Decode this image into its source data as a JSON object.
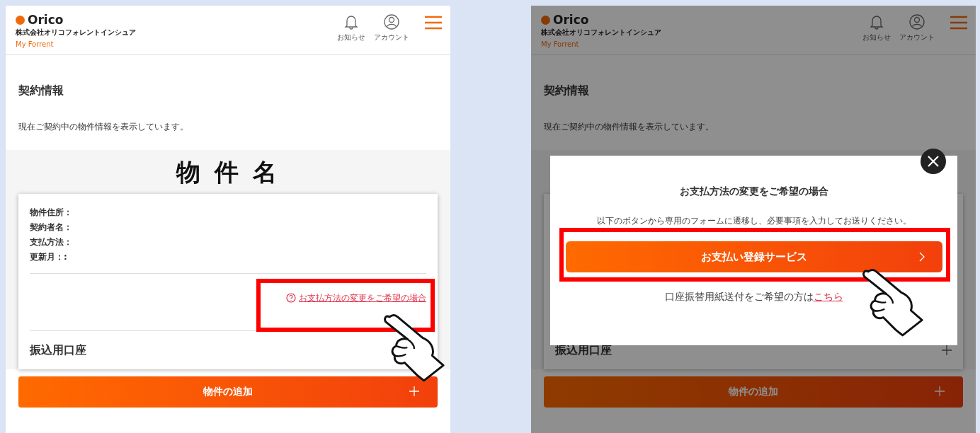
{
  "panels": [
    {
      "header": {
        "brand": "Orico",
        "company": "株式会社オリコフォレントインシュア",
        "service": "My Forrent",
        "notice": "お知らせ",
        "account": "アカウント"
      },
      "page_title": "契約情報",
      "description": "現在ご契約中の物件情報を表示しています。",
      "property_title": "物 件 名",
      "card": {
        "fields": [
          "物件住所：",
          "契約者名：",
          "支払方法：",
          "更新月：:"
        ],
        "link": "お支払方法の変更をご希望の場合",
        "account_label": "振込用口座"
      },
      "add_button": "物件の追加"
    },
    {
      "header": {
        "brand": "Orico",
        "company": "株式会社オリコフォレントインシュア",
        "service": "My Forrent",
        "notice": "お知らせ",
        "account": "アカウント"
      },
      "page_title": "契約情報",
      "description": "現在ご契約中の物件情報を表示しています。",
      "card": {
        "account_label": "振込用口座",
        "expandable": true
      },
      "add_button": "物件の追加",
      "dimmed": true,
      "modal": {
        "title": "お支払方法の変更をご希望の場合",
        "body": "以下のボタンから専用のフォームに遷移し、必要事項を入力してお送りください。",
        "button": "お支払い登録サービス",
        "note": "口座振替用紙送付をご希望の方は",
        "note_link": "こちら"
      }
    }
  ]
}
